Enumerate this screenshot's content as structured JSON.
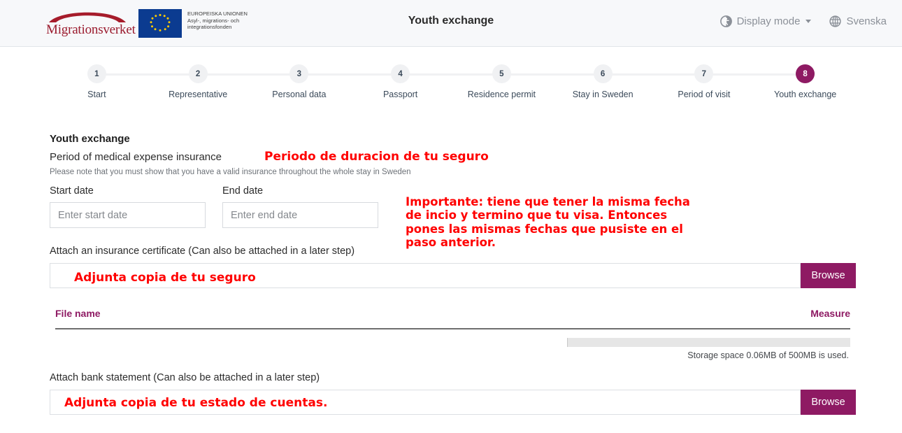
{
  "header": {
    "brand_name": "Migrationsverket",
    "eu_title": "EUROPEISKA UNIONEN",
    "eu_line1": "Asyl-, migrations- och",
    "eu_line2": "integrationsfonden",
    "page_title": "Youth exchange",
    "display_mode_label": "Display mode",
    "language_label": "Svenska",
    "accessibility_icon": "accessibility-icon",
    "globe_icon": "globe-icon",
    "caret_icon": "chevron-down-icon"
  },
  "stepper": {
    "steps": [
      {
        "number": "1",
        "label": "Start",
        "active": false
      },
      {
        "number": "2",
        "label": "Representative",
        "active": false
      },
      {
        "number": "3",
        "label": "Personal data",
        "active": false
      },
      {
        "number": "4",
        "label": "Passport",
        "active": false
      },
      {
        "number": "5",
        "label": "Residence permit",
        "active": false
      },
      {
        "number": "6",
        "label": "Stay in Sweden",
        "active": false
      },
      {
        "number": "7",
        "label": "Period of visit",
        "active": false
      },
      {
        "number": "8",
        "label": "Youth exchange",
        "active": true
      }
    ]
  },
  "form": {
    "section_title": "Youth exchange",
    "insurance_heading": "Period of medical expense insurance",
    "insurance_note": "Please note that you must show that you have a valid insurance throughout the whole stay in Sweden",
    "start_date_label": "Start date",
    "start_date_value": "",
    "start_date_placeholder": "Enter start date",
    "end_date_label": "End date",
    "end_date_value": "",
    "end_date_placeholder": "Enter end date",
    "insurance_attach_label": "Attach an insurance certificate  (Can also be attached in a later step)",
    "bank_attach_label": "Attach bank statement  (Can also be attached in a later step)",
    "browse_label": "Browse"
  },
  "file_table": {
    "col_file_name": "File name",
    "col_measure": "Measure",
    "rows": []
  },
  "storage": {
    "text": "Storage space 0.06MB of 500MB is used.",
    "used_mb": 0.06,
    "total_mb": 500,
    "percent": 0.012
  },
  "annotations": {
    "insurance_period": "Periodo de duracion de tu seguro",
    "dates": "Importante: tiene que tener la misma fecha\nde incio y termino que tu visa. Entonces\npones las mismas fechas que pusiste en el\npaso anterior.",
    "insurance_copy": "Adjunta copia de tu seguro",
    "bank_copy": "Adjunta copia de tu estado de cuentas."
  },
  "colors": {
    "brand_magenta": "#8e1a63",
    "brand_red": "#9b1b2e",
    "annotation_red": "#ff0000",
    "header_bg": "#f7f8fa",
    "step_inactive": "#f0f1f3"
  }
}
